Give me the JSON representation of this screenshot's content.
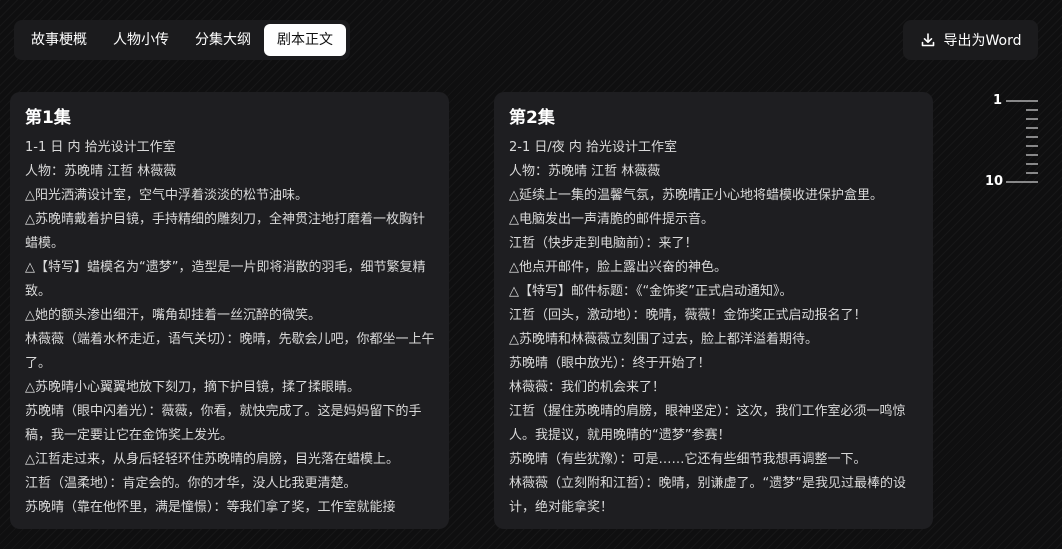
{
  "tabs": [
    {
      "label": "故事梗概",
      "active": false
    },
    {
      "label": "人物小传",
      "active": false
    },
    {
      "label": "分集大纲",
      "active": false
    },
    {
      "label": "剧本正文",
      "active": true
    }
  ],
  "export_button": {
    "label": "导出为Word",
    "icon": "download-icon"
  },
  "episodes": [
    {
      "title": "第1集",
      "lines": [
        "1-1 日 内 拾光设计工作室",
        "人物：苏晚晴 江哲 林薇薇",
        "△阳光洒满设计室，空气中浮着淡淡的松节油味。",
        "△苏晚晴戴着护目镜，手持精细的雕刻刀，全神贯注地打磨着一枚胸针蜡模。",
        "△【特写】蜡模名为“遗梦”，造型是一片即将消散的羽毛，细节繁复精致。",
        "△她的额头渗出细汗，嘴角却挂着一丝沉醉的微笑。",
        "林薇薇（端着水杯走近，语气关切）：晚晴，先歇会儿吧，你都坐一上午了。",
        "△苏晚晴小心翼翼地放下刻刀，摘下护目镜，揉了揉眼睛。",
        "苏晚晴（眼中闪着光）：薇薇，你看，就快完成了。这是妈妈留下的手稿，我一定要让它在金饰奖上发光。",
        "△江哲走过来，从身后轻轻环住苏晚晴的肩膀，目光落在蜡模上。",
        "江哲（温柔地）：肯定会的。你的才华，没人比我更清楚。",
        "苏晚晴（靠在他怀里，满是憧憬）：等我们拿了奖，工作室就能接"
      ]
    },
    {
      "title": "第2集",
      "lines": [
        "2-1 日/夜 内 拾光设计工作室",
        "人物：苏晚晴 江哲 林薇薇",
        "△延续上一集的温馨气氛，苏晚晴正小心地将蜡模收进保护盒里。",
        "△电脑发出一声清脆的邮件提示音。",
        "江哲（快步走到电脑前）：来了！",
        "△他点开邮件，脸上露出兴奋的神色。",
        "△【特写】邮件标题：《“金饰奖”正式启动通知》。",
        "江哲（回头，激动地）：晚晴，薇薇！金饰奖正式启动报名了！",
        "△苏晚晴和林薇薇立刻围了过去，脸上都洋溢着期待。",
        "苏晚晴（眼中放光）：终于开始了！",
        "林薇薇：我们的机会来了！",
        "江哲（握住苏晚晴的肩膀，眼神坚定）：这次，我们工作室必须一鸣惊人。我提议，就用晚晴的“遗梦”参赛！",
        "苏晚晴（有些犹豫）：可是……它还有些细节我想再调整一下。",
        "林薇薇（立刻附和江哲）：晚晴，别谦虚了。“遗梦”是我见过最棒的设计，绝对能拿奖！"
      ]
    }
  ],
  "navigator": {
    "start_label": "1",
    "end_label": "10"
  }
}
